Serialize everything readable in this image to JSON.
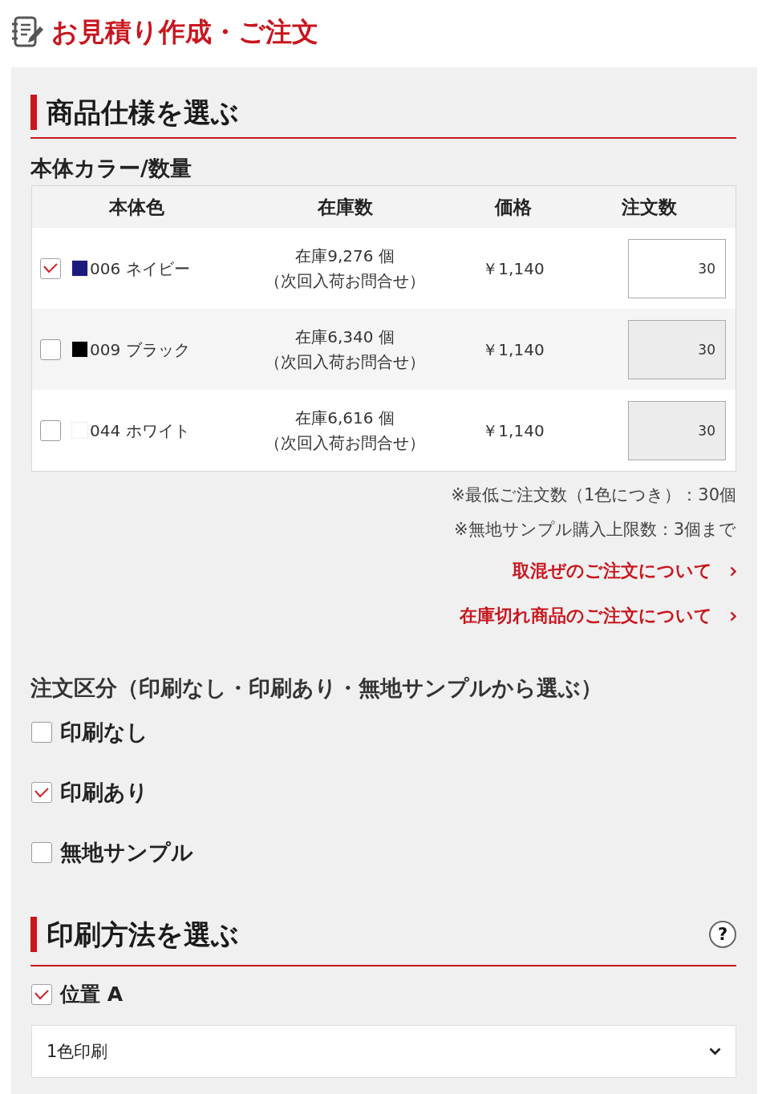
{
  "page_title": "お見積り作成・ご注文",
  "spec_section": {
    "title": "商品仕様を選ぶ",
    "subtitle": "本体カラー/数量",
    "table": {
      "columns": [
        "本体色",
        "在庫数",
        "価格",
        "注文数"
      ],
      "rows": [
        {
          "checked": true,
          "color": "#1a1a7e",
          "name": "006 ネイビー",
          "stock": "在庫9,276 個",
          "stock_note": "（次回入荷お問合せ）",
          "price": "￥1,140",
          "quantity": "30"
        },
        {
          "checked": false,
          "color": "#000000",
          "name": "009 ブラック",
          "stock": "在庫6,340 個",
          "stock_note": "（次回入荷お問合せ）",
          "price": "￥1,140",
          "quantity": "30"
        },
        {
          "checked": false,
          "color": "#ffffff",
          "name": "044 ホワイト",
          "stock": "在庫6,616 個",
          "stock_note": "（次回入荷お問合せ）",
          "price": "￥1,140",
          "quantity": "30"
        }
      ]
    },
    "notes": [
      "※最低ご注文数（1色につき）：30個",
      "※無地サンプル購入上限数：3個まで"
    ],
    "links": [
      "取混ぜのご注文について",
      "在庫切れ商品のご注文について"
    ]
  },
  "order_type": {
    "title": "注文区分（印刷なし・印刷あり・無地サンプルから選ぶ）",
    "options": [
      {
        "label": "印刷なし",
        "checked": false
      },
      {
        "label": "印刷あり",
        "checked": true
      },
      {
        "label": "無地サンプル",
        "checked": false
      }
    ]
  },
  "print_section": {
    "title": "印刷方法を選ぶ",
    "help_button": "?",
    "positions": [
      {
        "label": "位置 A",
        "checked": true
      }
    ],
    "select": {
      "value": "1色印刷"
    }
  }
}
